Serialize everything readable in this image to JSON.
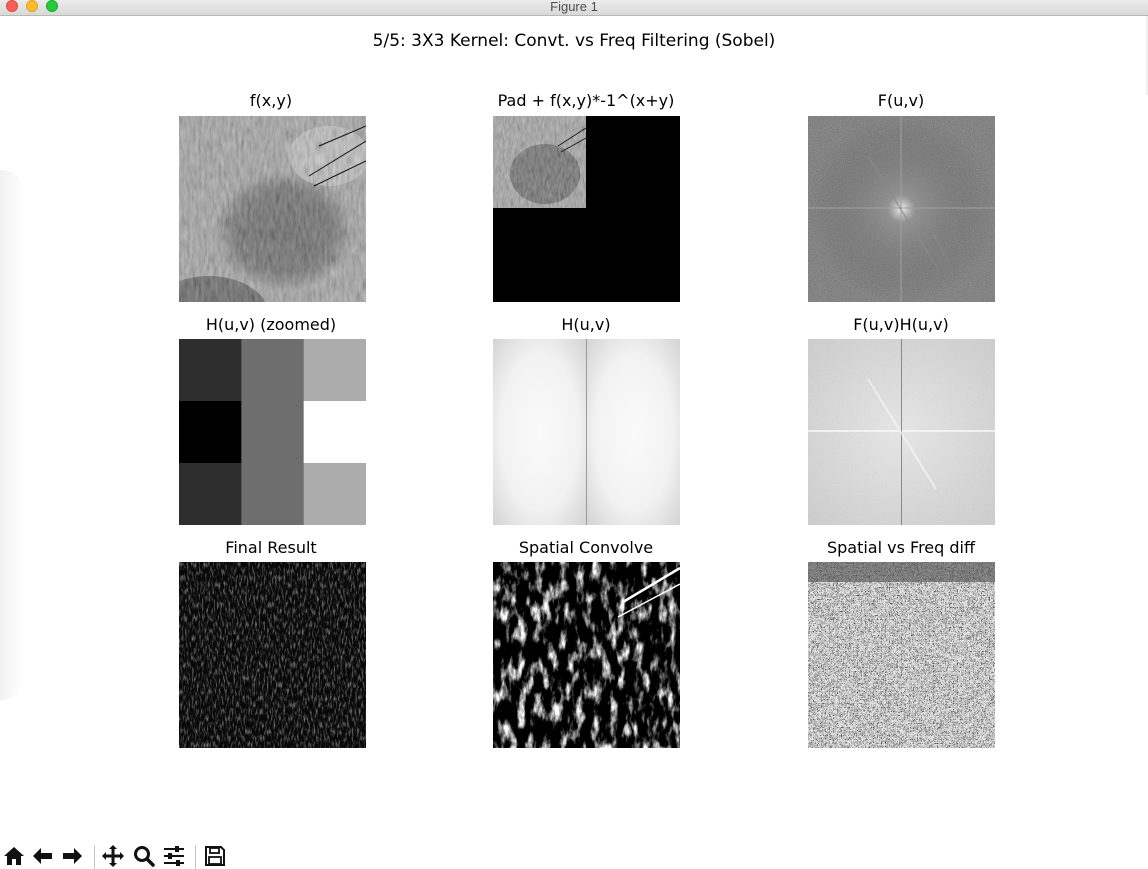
{
  "window": {
    "title": "Figure 1"
  },
  "figure": {
    "suptitle": "5/5: 3X3 Kernel: Convt. vs Freq Filtering (Sobel)",
    "subplots": [
      {
        "title": "f(x,y)"
      },
      {
        "title": "Pad + f(x,y)*-1^(x+y)"
      },
      {
        "title": "F(u,v)"
      },
      {
        "title": "H(u,v) (zoomed)"
      },
      {
        "title": "H(u,v)"
      },
      {
        "title": "F(u,v)H(u,v)"
      },
      {
        "title": "Final Result"
      },
      {
        "title": "Spatial Convolve"
      },
      {
        "title": "Spatial vs Freq diff"
      }
    ],
    "kernel_gray_levels": [
      [
        "#2e2e2e",
        "#6e6e6e",
        "#acacac"
      ],
      [
        "#000000",
        "#6e6e6e",
        "#ffffff"
      ],
      [
        "#2e2e2e",
        "#6e6e6e",
        "#acacac"
      ]
    ]
  },
  "toolbar": {
    "buttons": [
      {
        "name": "home",
        "icon": "home-icon"
      },
      {
        "name": "back",
        "icon": "arrow-left-icon"
      },
      {
        "name": "forward",
        "icon": "arrow-right-icon"
      },
      {
        "name": "pan",
        "icon": "move-icon"
      },
      {
        "name": "zoom",
        "icon": "magnifier-icon"
      },
      {
        "name": "configure-subplots",
        "icon": "sliders-icon"
      },
      {
        "name": "save",
        "icon": "floppy-disk-icon"
      }
    ]
  }
}
